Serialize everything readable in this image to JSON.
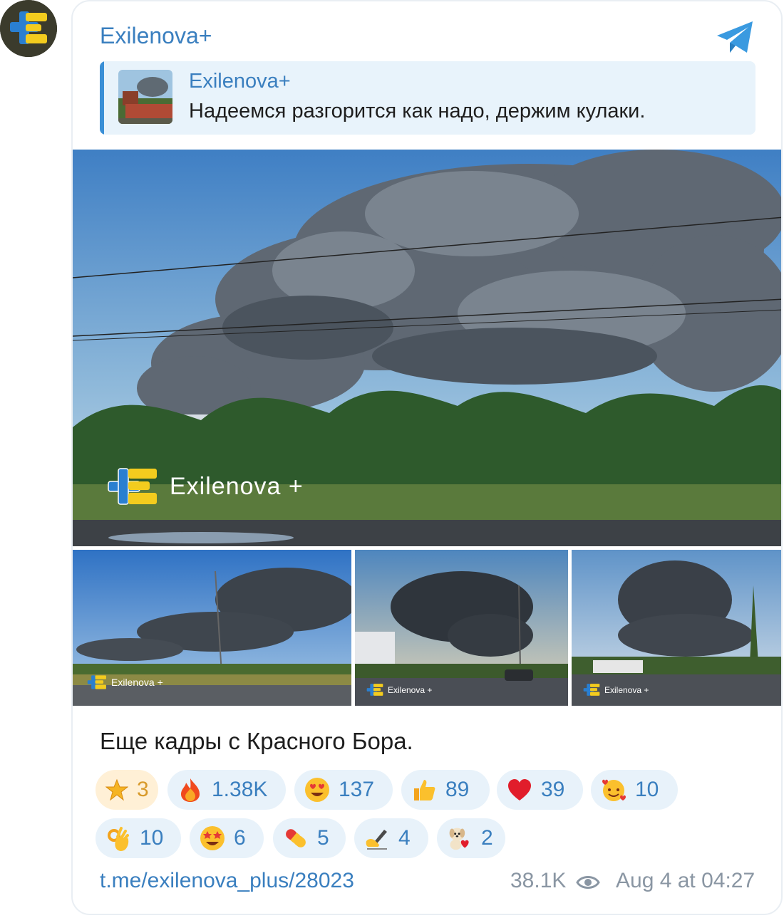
{
  "channel": {
    "name": "Exilenova+"
  },
  "forward": {
    "name": "Exilenova+",
    "text": "Надеемся разгорится как надо, держим кулаки."
  },
  "photos": {
    "watermark": "Exilenova +"
  },
  "caption": "Еще кадры с Красного Бора.",
  "reactions": [
    {
      "emoji": "star",
      "count": "3",
      "active": true
    },
    {
      "emoji": "fire",
      "count": "1.38K"
    },
    {
      "emoji": "heart-eyes",
      "count": "137"
    },
    {
      "emoji": "thumbs-up",
      "count": "89"
    },
    {
      "emoji": "red-heart",
      "count": "39"
    },
    {
      "emoji": "smiling-hearts",
      "count": "10"
    },
    {
      "emoji": "ok-hand",
      "count": "10"
    },
    {
      "emoji": "star-struck",
      "count": "6"
    },
    {
      "emoji": "pill",
      "count": "5"
    },
    {
      "emoji": "writing-hand",
      "count": "4"
    },
    {
      "emoji": "puppy-heart",
      "count": "2"
    }
  ],
  "footer": {
    "link": "t.me/exilenova_plus/28023",
    "views": "38.1K",
    "time": "Aug 4 at 04:27"
  },
  "colors": {
    "accent": "#3a7fbf",
    "quote_bg": "#e8f3fb",
    "reaction_bg": "#e8f2fa",
    "reaction_active_bg": "#fff0d6"
  }
}
